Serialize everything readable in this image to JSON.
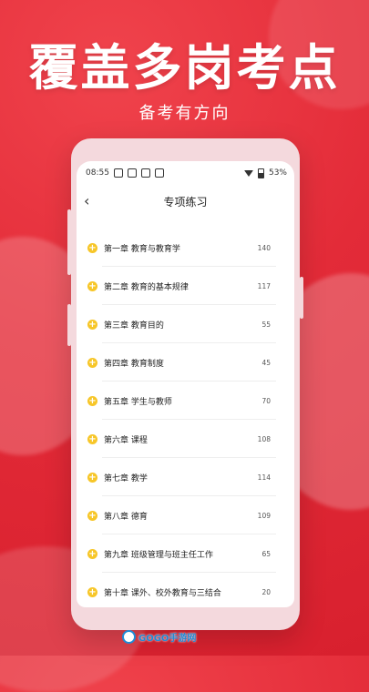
{
  "headline": "覆盖多岗考点",
  "subhead": "备考有方向",
  "phone": {
    "status": {
      "time": "08:55",
      "battery": "53%"
    },
    "title": "专项练习",
    "chapters": [
      {
        "label": "第一章 教育与教育学",
        "count": "140"
      },
      {
        "label": "第二章 教育的基本规律",
        "count": "117"
      },
      {
        "label": "第三章 教育目的",
        "count": "55"
      },
      {
        "label": "第四章 教育制度",
        "count": "45"
      },
      {
        "label": "第五章 学生与教师",
        "count": "70"
      },
      {
        "label": "第六章 课程",
        "count": "108"
      },
      {
        "label": "第七章 教学",
        "count": "114"
      },
      {
        "label": "第八章 德育",
        "count": "109"
      },
      {
        "label": "第九章 班级管理与班主任工作",
        "count": "65"
      },
      {
        "label": "第十章 课外、校外教育与三结合",
        "count": "20"
      }
    ]
  },
  "watermark": "GOGO手游网",
  "icons": {
    "back": "back-arrow-icon",
    "plus": "plus-circle-icon",
    "wifi": "wifi-icon",
    "battery": "battery-icon"
  },
  "colors": {
    "background": "#e32b38",
    "accent": "#f7c628"
  }
}
